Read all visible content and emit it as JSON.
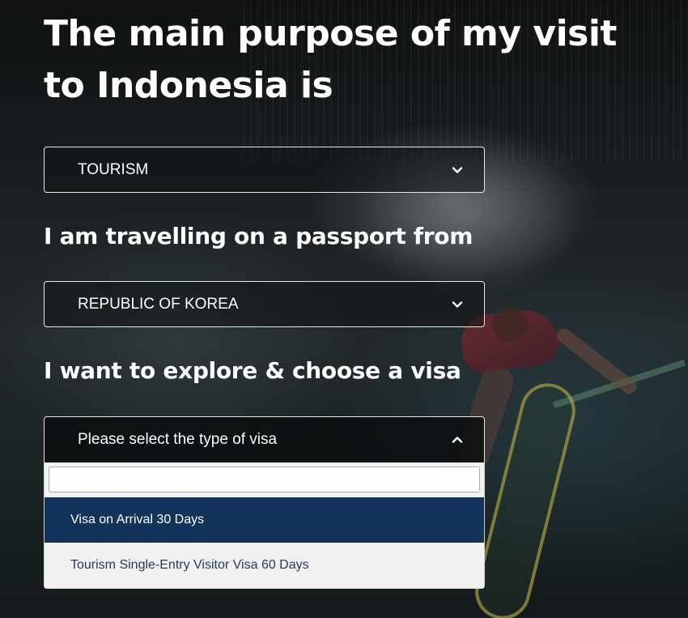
{
  "heading": "The main purpose of my visit to Indonesia is",
  "purpose_select": {
    "value": "TOURISM",
    "icon": "chevron-down-icon"
  },
  "passport_question": "I am travelling on a passport from",
  "passport_select": {
    "value": "REPUBLIC OF KOREA",
    "icon": "chevron-down-icon"
  },
  "visa_question": "I want to explore & choose a visa",
  "visa_select": {
    "placeholder": "Please select the type of visa",
    "icon": "chevron-up-icon",
    "search_value": "",
    "options": [
      {
        "label": "Visa on Arrival 30 Days",
        "highlighted": true
      },
      {
        "label": "Tourism Single-Entry Visitor Visa 60 Days",
        "highlighted": false
      }
    ]
  },
  "colors": {
    "highlight": "#12345a",
    "option_text": "#1f3a5c",
    "dropdown_bg": "#f1f1f1",
    "text": "#ffffff"
  }
}
